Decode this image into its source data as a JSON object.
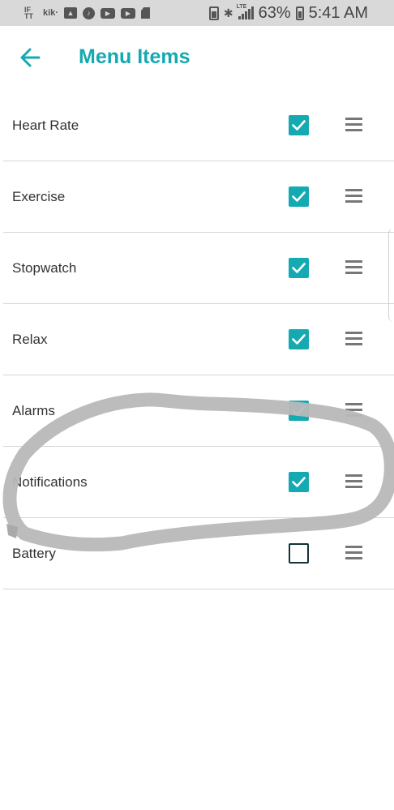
{
  "status_bar": {
    "time": "5:41 AM",
    "battery_percent": "63%",
    "network": "LTE",
    "kik_label": "kik·",
    "ifttt_label": "IFTTT",
    "icons": [
      "ifttt-icon",
      "kik-icon",
      "gallery-icon",
      "music-icon",
      "youtube-icon",
      "youtube-icon",
      "sd-card-icon",
      "battery-saver-icon",
      "bluetooth-icon",
      "signal-icon",
      "battery-icon"
    ]
  },
  "header": {
    "title": "Menu Items",
    "back_icon": "arrow-left-icon"
  },
  "colors": {
    "accent": "#15a9b1",
    "annotation": "#b5b5b5",
    "divider": "#d6d6d6"
  },
  "menu_items": [
    {
      "label": "Heart Rate",
      "checked": true
    },
    {
      "label": "Exercise",
      "checked": true
    },
    {
      "label": "Stopwatch",
      "checked": true
    },
    {
      "label": "Relax",
      "checked": true
    },
    {
      "label": "Alarms",
      "checked": true
    },
    {
      "label": "Notifications",
      "checked": true
    },
    {
      "label": "Battery",
      "checked": false
    }
  ]
}
